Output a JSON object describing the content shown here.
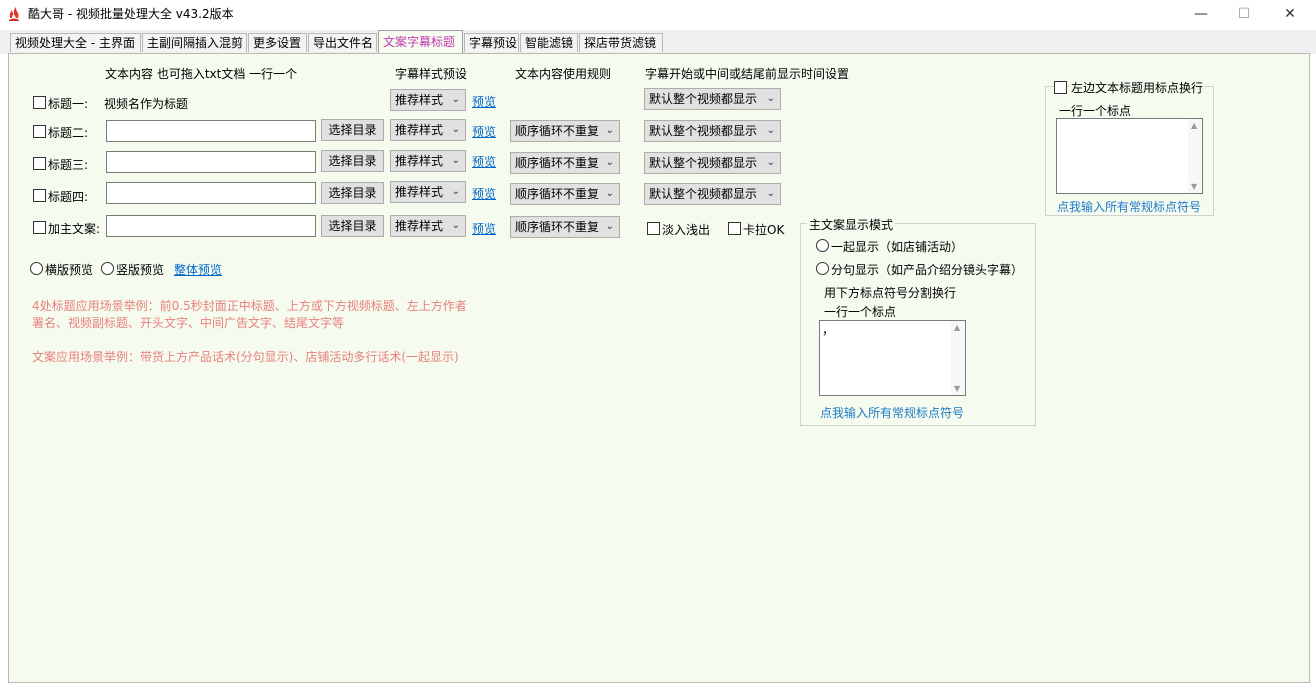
{
  "window": {
    "title": "酷大哥 -  视频批量处理大全  v43.2版本",
    "minimize_glyph": "—",
    "maximize_glyph": "☐",
    "close_glyph": "✕"
  },
  "tabs": [
    {
      "label": "视频处理大全 - 主界面",
      "active": false
    },
    {
      "label": "主副间隔插入混剪",
      "active": false
    },
    {
      "label": "更多设置",
      "active": false
    },
    {
      "label": "导出文件名",
      "active": false
    },
    {
      "label": "文案字幕标题",
      "active": true
    },
    {
      "label": "字幕预设",
      "active": false
    },
    {
      "label": "智能滤镜",
      "active": false
    },
    {
      "label": "探店带货滤镜",
      "active": false
    }
  ],
  "headers": {
    "text_content": "文本内容 也可拖入txt文档 一行一个",
    "style_preset": "字幕样式预设",
    "usage_rule": "文本内容使用规则",
    "time_setting": "字幕开始或中间或结尾前显示时间设置"
  },
  "rows": [
    {
      "label": "标题一:",
      "static_value": "视频名作为标题",
      "select_dir": "",
      "style": "推荐样式",
      "preview": "预览",
      "rule": "",
      "time": "默认整个视频都显示"
    },
    {
      "label": "标题二:",
      "static_value": "",
      "select_dir": "选择目录",
      "style": "推荐样式",
      "preview": "预览",
      "rule": "顺序循环不重复",
      "time": "默认整个视频都显示"
    },
    {
      "label": "标题三:",
      "static_value": "",
      "select_dir": "选择目录",
      "style": "推荐样式",
      "preview": "预览",
      "rule": "顺序循环不重复",
      "time": "默认整个视频都显示"
    },
    {
      "label": "标题四:",
      "static_value": "",
      "select_dir": "选择目录",
      "style": "推荐样式",
      "preview": "预览",
      "rule": "顺序循环不重复",
      "time": "默认整个视频都显示"
    },
    {
      "label": "加主文案:",
      "static_value": "",
      "select_dir": "选择目录",
      "style": "推荐样式",
      "preview": "预览",
      "rule": "顺序循环不重复",
      "time": ""
    }
  ],
  "fade": {
    "fade_label": "淡入浅出",
    "karaoke_label": "卡拉OK"
  },
  "preview_modes": {
    "landscape": "横版预览",
    "portrait": "竖版预览",
    "overall": "整体预览"
  },
  "notes": {
    "line1": "4处标题应用场景举例：前0.5秒封面正中标题、上方或下方视频标题、左上方作者",
    "line2": "署名、视频副标题、开头文字、中间广告文字、结尾文字等",
    "line3": "文案应用场景举例：带货上方产品话术(分句显示)、店铺活动多行话术(一起显示)"
  },
  "main_copy_mode": {
    "title": "主文案显示模式",
    "option_together": "一起显示（如店铺活动）",
    "option_sentence": "分句显示（如产品介绍分镜头字幕）",
    "split_hint": "用下方标点符号分割换行",
    "one_per_line": "一行一个标点",
    "textarea_value": "，",
    "link": "点我输入所有常规标点符号"
  },
  "left_wrap": {
    "checkbox_label": "左边文本标题用标点换行",
    "one_per_line": "一行一个标点",
    "textarea_value": "",
    "link": "点我输入所有常规标点符号"
  }
}
